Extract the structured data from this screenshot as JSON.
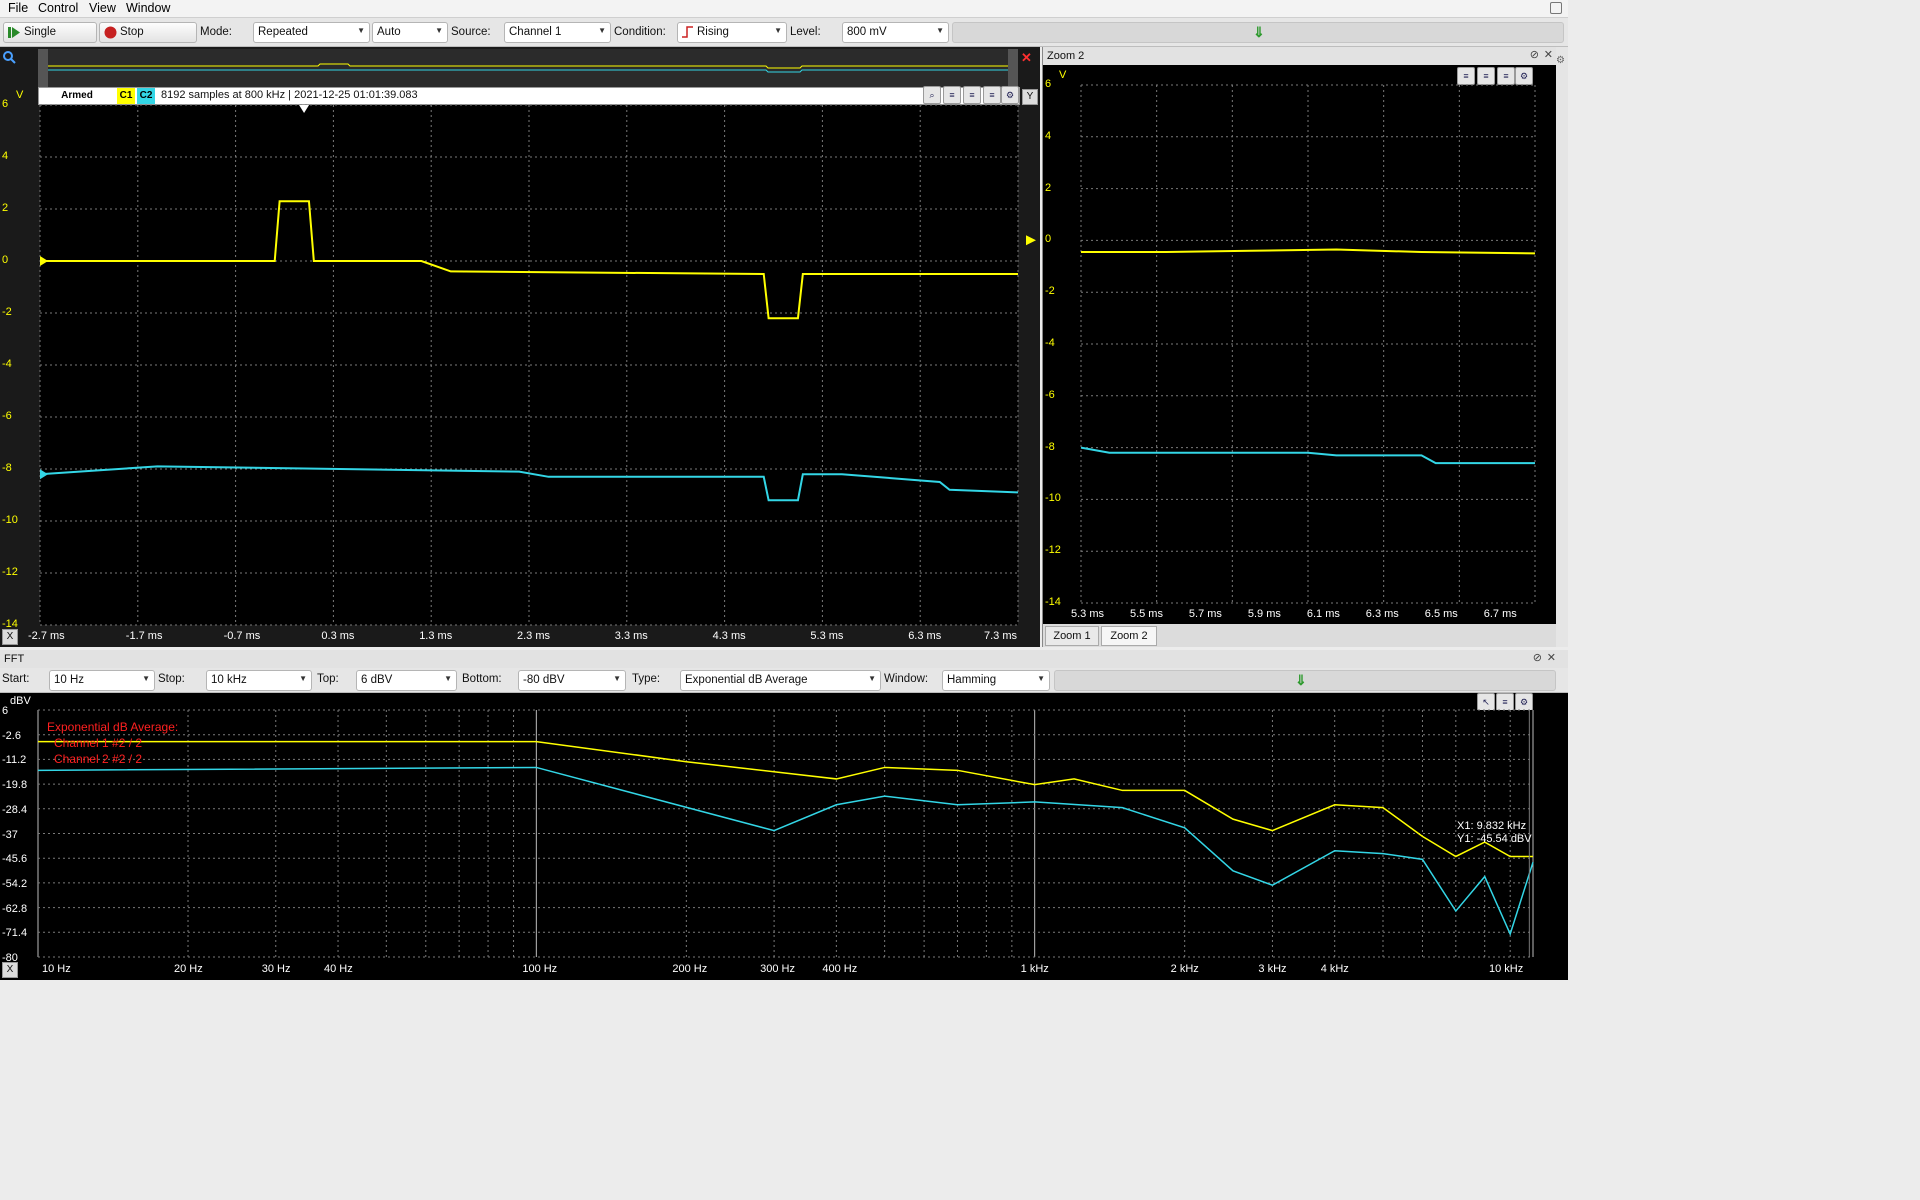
{
  "menu": [
    "File",
    "Control",
    "View",
    "Window"
  ],
  "toolbar": {
    "single_label": "Single",
    "stop_label": "Stop",
    "mode_label": "Mode:",
    "mode_value": "Repeated",
    "auto_value": "Auto",
    "source_label": "Source:",
    "source_value": "Channel 1",
    "condition_label": "Condition:",
    "condition_value": "Rising",
    "level_label": "Level:",
    "level_value": "800 mV",
    "down_arrow": "⇓"
  },
  "scope": {
    "status": "Armed",
    "c1": "C1",
    "c2": "C2",
    "info": "8192 samples at 800 kHz | 2021-12-25 01:01:39.083",
    "y_unit": "V",
    "y_ticks": [
      "6",
      "4",
      "2",
      "0",
      "-2",
      "-4",
      "-6",
      "-8",
      "-10",
      "-12",
      "-14"
    ],
    "x_ticks": [
      "-2.7 ms",
      "-1.7 ms",
      "-0.7 ms",
      "0.3 ms",
      "1.3 ms",
      "2.3 ms",
      "3.3 ms",
      "4.3 ms",
      "5.3 ms",
      "6.3 ms",
      "7.3 ms"
    ],
    "x_button": "X",
    "y_button": "Y",
    "close_mark": "✕"
  },
  "zoom": {
    "title": "Zoom 2",
    "y_unit": "V",
    "y_ticks": [
      "6",
      "4",
      "2",
      "0",
      "-2",
      "-4",
      "-6",
      "-8",
      "-10",
      "-12",
      "-14"
    ],
    "x_ticks": [
      "5.3 ms",
      "5.5 ms",
      "5.7 ms",
      "5.9 ms",
      "6.1 ms",
      "6.3 ms",
      "6.5 ms",
      "6.7 ms"
    ],
    "tabs": [
      "Zoom 1",
      "Zoom 2"
    ]
  },
  "fft": {
    "title": "FFT",
    "start_label": "Start:",
    "start_value": "10 Hz",
    "stop_label": "Stop:",
    "stop_value": "10 kHz",
    "top_label": "Top:",
    "top_value": "6 dBV",
    "bottom_label": "Bottom:",
    "bottom_value": "-80 dBV",
    "type_label": "Type:",
    "type_value": "Exponential dB Average",
    "window_label": "Window:",
    "window_value": "Hamming",
    "y_unit": "dBV",
    "y_ticks": [
      "6",
      "-2.6",
      "-11.2",
      "-19.8",
      "-28.4",
      "-37",
      "-45.6",
      "-54.2",
      "-62.8",
      "-71.4",
      "-80"
    ],
    "x_ticks": [
      "10 Hz",
      "20 Hz",
      "30 Hz",
      "40 Hz",
      "100 Hz",
      "200 Hz",
      "300 Hz",
      "400 Hz",
      "1 kHz",
      "2 kHz",
      "3 kHz",
      "4 kHz",
      "10 kHz"
    ],
    "legend_title": "Exponential dB Average:",
    "legend_items": [
      "Channel 1 #2 / 2",
      "Channel 2 #2 / 2"
    ],
    "cursor_x": "X1: 9.832 kHz",
    "cursor_y": "Y1: -45.54 dBV",
    "x_button": "X"
  },
  "colors": {
    "ch1": "#ffff00",
    "ch2": "#33d6e6",
    "legend": "#ff2020",
    "grid": "#7a7a7a"
  },
  "chart_data": [
    {
      "type": "line",
      "title": "",
      "xlabel": "",
      "ylabel": "V",
      "xlim": [
        -2.7,
        7.3
      ],
      "ylim": [
        -14,
        6
      ],
      "series": [
        {
          "name": "C1",
          "x": [
            -2.7,
            -0.3,
            -0.25,
            0.05,
            0.1,
            1.2,
            1.5,
            4.7,
            4.75,
            5.05,
            5.1,
            7.3
          ],
          "y": [
            0,
            0,
            2.3,
            2.3,
            0,
            0,
            -0.4,
            -0.5,
            -2.2,
            -2.2,
            -0.5,
            -0.5
          ]
        },
        {
          "name": "C2",
          "x": [
            -2.7,
            -1.5,
            2.2,
            2.5,
            4.7,
            4.75,
            5.05,
            5.1,
            5.5,
            6.5,
            6.6,
            7.3
          ],
          "y": [
            -8.2,
            -7.9,
            -8.1,
            -8.3,
            -8.3,
            -9.2,
            -9.2,
            -8.2,
            -8.2,
            -8.5,
            -8.8,
            -8.9
          ]
        }
      ]
    },
    {
      "type": "line",
      "title": "Zoom 2",
      "xlabel": "",
      "ylabel": "V",
      "xlim": [
        5.2,
        6.8
      ],
      "ylim": [
        -14,
        6
      ],
      "series": [
        {
          "name": "C1",
          "x": [
            5.2,
            5.5,
            5.8,
            6.1,
            6.4,
            6.8
          ],
          "y": [
            -0.45,
            -0.45,
            -0.4,
            -0.35,
            -0.45,
            -0.5
          ]
        },
        {
          "name": "C2",
          "x": [
            5.2,
            5.3,
            5.6,
            6.0,
            6.1,
            6.4,
            6.45,
            6.8
          ],
          "y": [
            -8.0,
            -8.2,
            -8.2,
            -8.2,
            -8.3,
            -8.3,
            -8.6,
            -8.6
          ]
        }
      ]
    },
    {
      "type": "line",
      "title": "FFT",
      "xlabel": "",
      "ylabel": "dBV",
      "xscale": "log",
      "xlim": [
        10,
        10000
      ],
      "ylim": [
        -80,
        6
      ],
      "series": [
        {
          "name": "Channel 1 #2 / 2",
          "x": [
            10,
            100,
            200,
            400,
            500,
            700,
            1000,
            1200,
            1500,
            2000,
            2500,
            3000,
            4000,
            5000,
            6000,
            7000,
            8000,
            9000,
            10000
          ],
          "y": [
            -5,
            -5,
            -12,
            -18,
            -14,
            -15,
            -20,
            -18,
            -22,
            -22,
            -32,
            -36,
            -27,
            -28,
            -38,
            -45,
            -40,
            -45,
            -45
          ]
        },
        {
          "name": "Channel 2 #2 / 2",
          "x": [
            10,
            100,
            300,
            400,
            500,
            700,
            1000,
            1500,
            2000,
            2500,
            3000,
            4000,
            5000,
            6000,
            7000,
            8000,
            9000,
            10000
          ],
          "y": [
            -15,
            -14,
            -36,
            -27,
            -24,
            -27,
            -26,
            -28,
            -35,
            -50,
            -55,
            -43,
            -44,
            -46,
            -64,
            -52,
            -72,
            -47
          ]
        }
      ]
    }
  ]
}
